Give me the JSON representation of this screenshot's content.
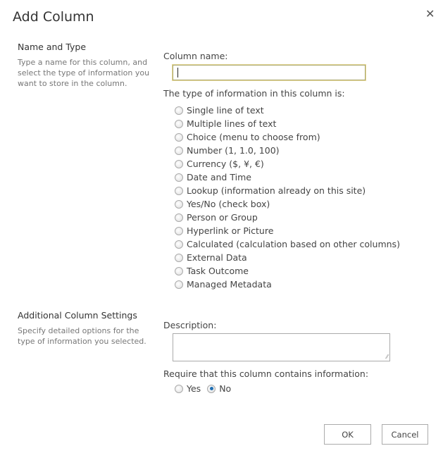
{
  "dialog": {
    "title": "Add Column",
    "close_icon": "close-icon"
  },
  "name_type": {
    "title": "Name and Type",
    "description": "Type a name for this column, and select the type of information you want to store in the column.",
    "column_name_label": "Column name:",
    "column_name_value": "",
    "type_label": "The type of information in this column is:",
    "types": [
      {
        "label": "Single line of text",
        "checked": false
      },
      {
        "label": "Multiple lines of text",
        "checked": false
      },
      {
        "label": "Choice (menu to choose from)",
        "checked": false
      },
      {
        "label": "Number (1, 1.0, 100)",
        "checked": false
      },
      {
        "label": "Currency ($, ¥, €)",
        "checked": false
      },
      {
        "label": "Date and Time",
        "checked": false
      },
      {
        "label": "Lookup (information already on this site)",
        "checked": false
      },
      {
        "label": "Yes/No (check box)",
        "checked": false
      },
      {
        "label": "Person or Group",
        "checked": false
      },
      {
        "label": "Hyperlink or Picture",
        "checked": false
      },
      {
        "label": "Calculated (calculation based on other columns)",
        "checked": false
      },
      {
        "label": "External Data",
        "checked": false
      },
      {
        "label": "Task Outcome",
        "checked": false
      },
      {
        "label": "Managed Metadata",
        "checked": false
      }
    ]
  },
  "additional": {
    "title": "Additional Column Settings",
    "description": "Specify detailed options for the type of information you selected.",
    "description_label": "Description:",
    "description_value": "",
    "require_label": "Require that this column contains information:",
    "require_options": [
      {
        "label": "Yes",
        "checked": false
      },
      {
        "label": "No",
        "checked": true
      }
    ]
  },
  "buttons": {
    "ok": "OK",
    "cancel": "Cancel"
  }
}
